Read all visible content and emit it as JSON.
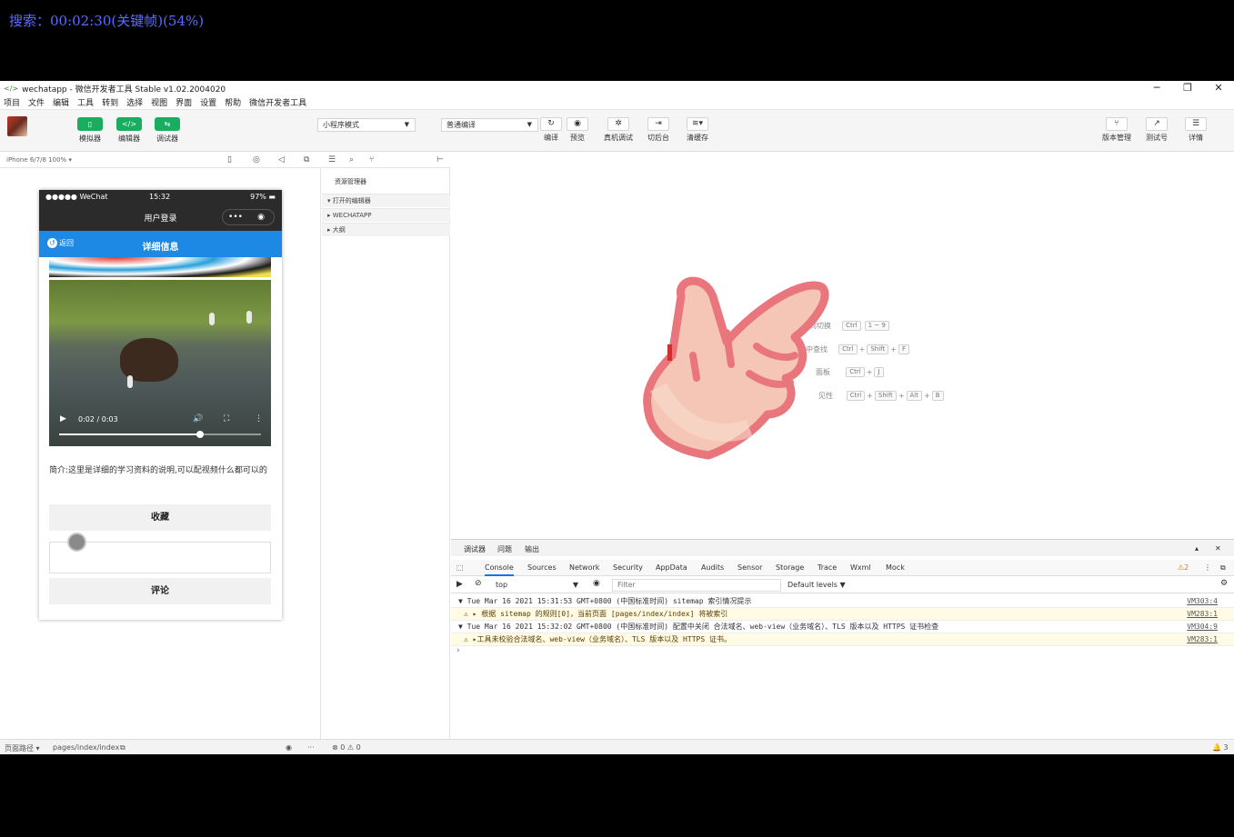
{
  "overlay": {
    "text": "搜索：00:02:30(关键帧)(54%)"
  },
  "window": {
    "title": "wechatapp - 微信开发者工具 Stable v1.02.2004020",
    "controls": [
      "─",
      "❐",
      "✕"
    ]
  },
  "menu": [
    "项目",
    "文件",
    "编辑",
    "工具",
    "转到",
    "选择",
    "视图",
    "界面",
    "设置",
    "帮助",
    "微信开发者工具"
  ],
  "toolbar": {
    "simulator_label": "模拟器",
    "editor_label": "编辑器",
    "debugger_label": "调试器",
    "mode_value": "小程序模式",
    "compile_value": "普通编译",
    "compile_label": "编译",
    "preview_label": "预览",
    "realdebug_label": "真机调试",
    "background_label": "切后台",
    "clearcache_label": "清缓存",
    "version_label": "版本管理",
    "testid_label": "测试号",
    "details_label": "详情",
    "accent": "#1aad5f"
  },
  "simulator": {
    "device": "iPhone 6/7/8 100% ▾"
  },
  "phone": {
    "carrier": "●●●●● WeChat",
    "time": "15:32",
    "battery": "97%",
    "nav_title": "用户登录",
    "capsule_more": "•••",
    "capsule_close": "◉",
    "back_label": "返回",
    "header_title": "详细信息",
    "header_color": "#1e88e5",
    "video_time": "0:02 / 0:03",
    "video_progress": 0.7,
    "description": "简介:这里是详细的学习资料的说明,可以配视频什么都可以的",
    "favorite_button": "收藏",
    "comment_button": "评论"
  },
  "explorer": {
    "title": "资源管理器",
    "sections": [
      "打开的编辑器",
      "WECHATAPP",
      "大纲"
    ]
  },
  "editor": {
    "shortcuts": [
      {
        "label": "间切换",
        "keys": [
          "Ctrl",
          "1 ~ 9"
        ]
      },
      {
        "label": "中查找",
        "keys": [
          "Ctrl",
          "+",
          "Shift",
          "+",
          "F"
        ]
      },
      {
        "label": "面板",
        "keys": [
          "Ctrl",
          "+",
          "J"
        ]
      },
      {
        "label": "见性",
        "keys": [
          "Ctrl",
          "+",
          "Shift",
          "+",
          "Alt",
          "+",
          "B"
        ]
      }
    ]
  },
  "debugger": {
    "tabs": [
      "调试器",
      "问题",
      "输出"
    ],
    "console_tabs": [
      "Console",
      "Sources",
      "Network",
      "Security",
      "AppData",
      "Audits",
      "Sensor",
      "Storage",
      "Trace",
      "Wxml",
      "Mock"
    ],
    "warn_count": "⚠2",
    "context": "top",
    "filter_placeholder": "Filter",
    "levels": "Default levels ▼",
    "logs": [
      {
        "type": "group",
        "text": "▼ Tue Mar 16 2021 15:31:53 GMT+0800 (中国标准时间) sitemap 索引情况提示",
        "src": "VM303:4"
      },
      {
        "type": "warn",
        "text": "⚠ ▸ 根据 sitemap 的规则[0]，当前页面 [pages/index/index] 将被索引",
        "src": "VM283:1"
      },
      {
        "type": "group",
        "text": "▼ Tue Mar 16 2021 15:32:02 GMT+0800 (中国标准时间) 配置中关闭 合法域名、web-view（业务域名）、TLS 版本以及 HTTPS 证书检查",
        "src": "VM304:9"
      },
      {
        "type": "warn",
        "text": "⚠ ▸工具未校验合法域名、web-view（业务域名）、TLS 版本以及 HTTPS 证书。",
        "src": "VM283:1"
      }
    ]
  },
  "statusbar": {
    "path_label": "页面路径 ▾",
    "path": "pages/index/index",
    "errors": "⊗ 0 ⚠ 0",
    "notifications": "🔔 3"
  }
}
